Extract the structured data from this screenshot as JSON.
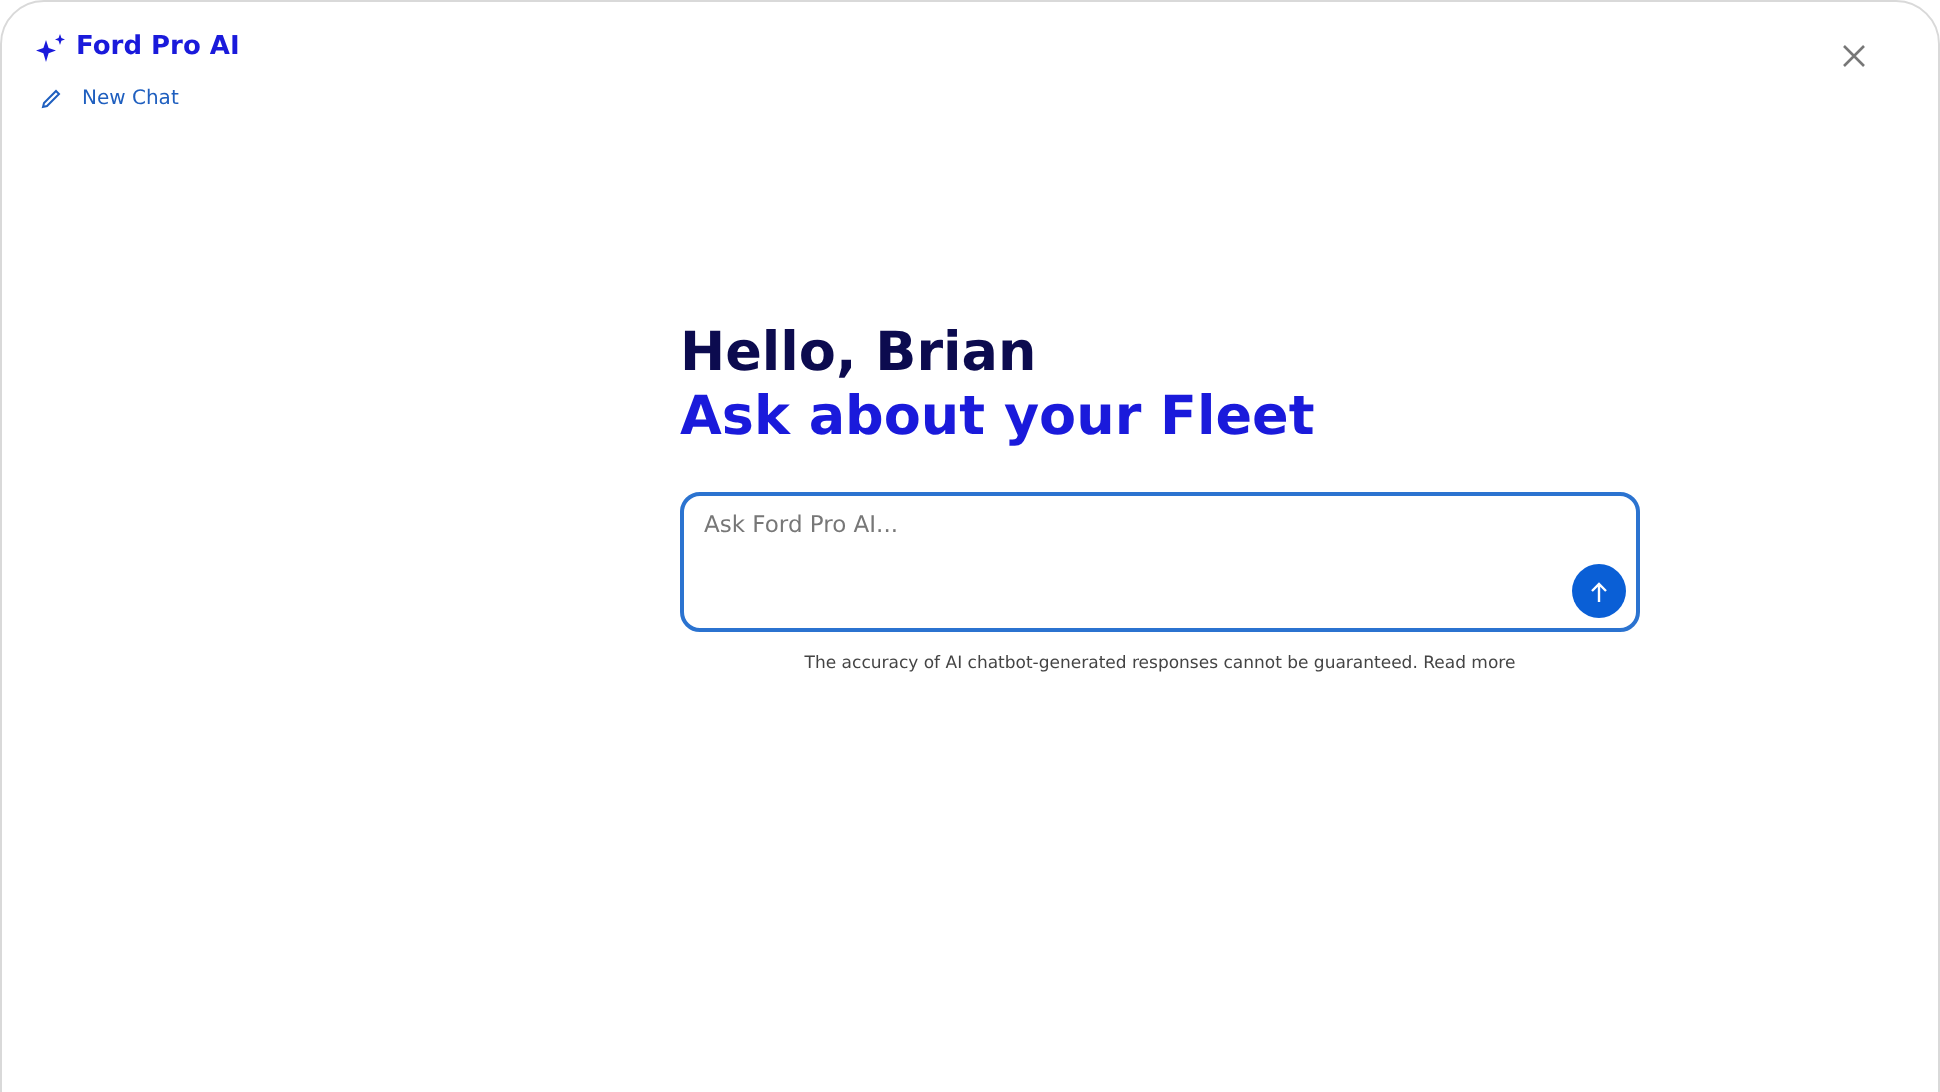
{
  "header": {
    "title": "Ford Pro AI"
  },
  "sidebar": {
    "new_chat": "New Chat"
  },
  "greeting": {
    "line_1": "Hello, Brian",
    "line_2": "Ask about your Fleet"
  },
  "prompt": {
    "placeholder": "Ask Ford Pro AI..."
  },
  "disclaimer": {
    "text": "The accuracy of AI chatbot-generated responses cannot be guaranteed.",
    "link": "Read more"
  }
}
